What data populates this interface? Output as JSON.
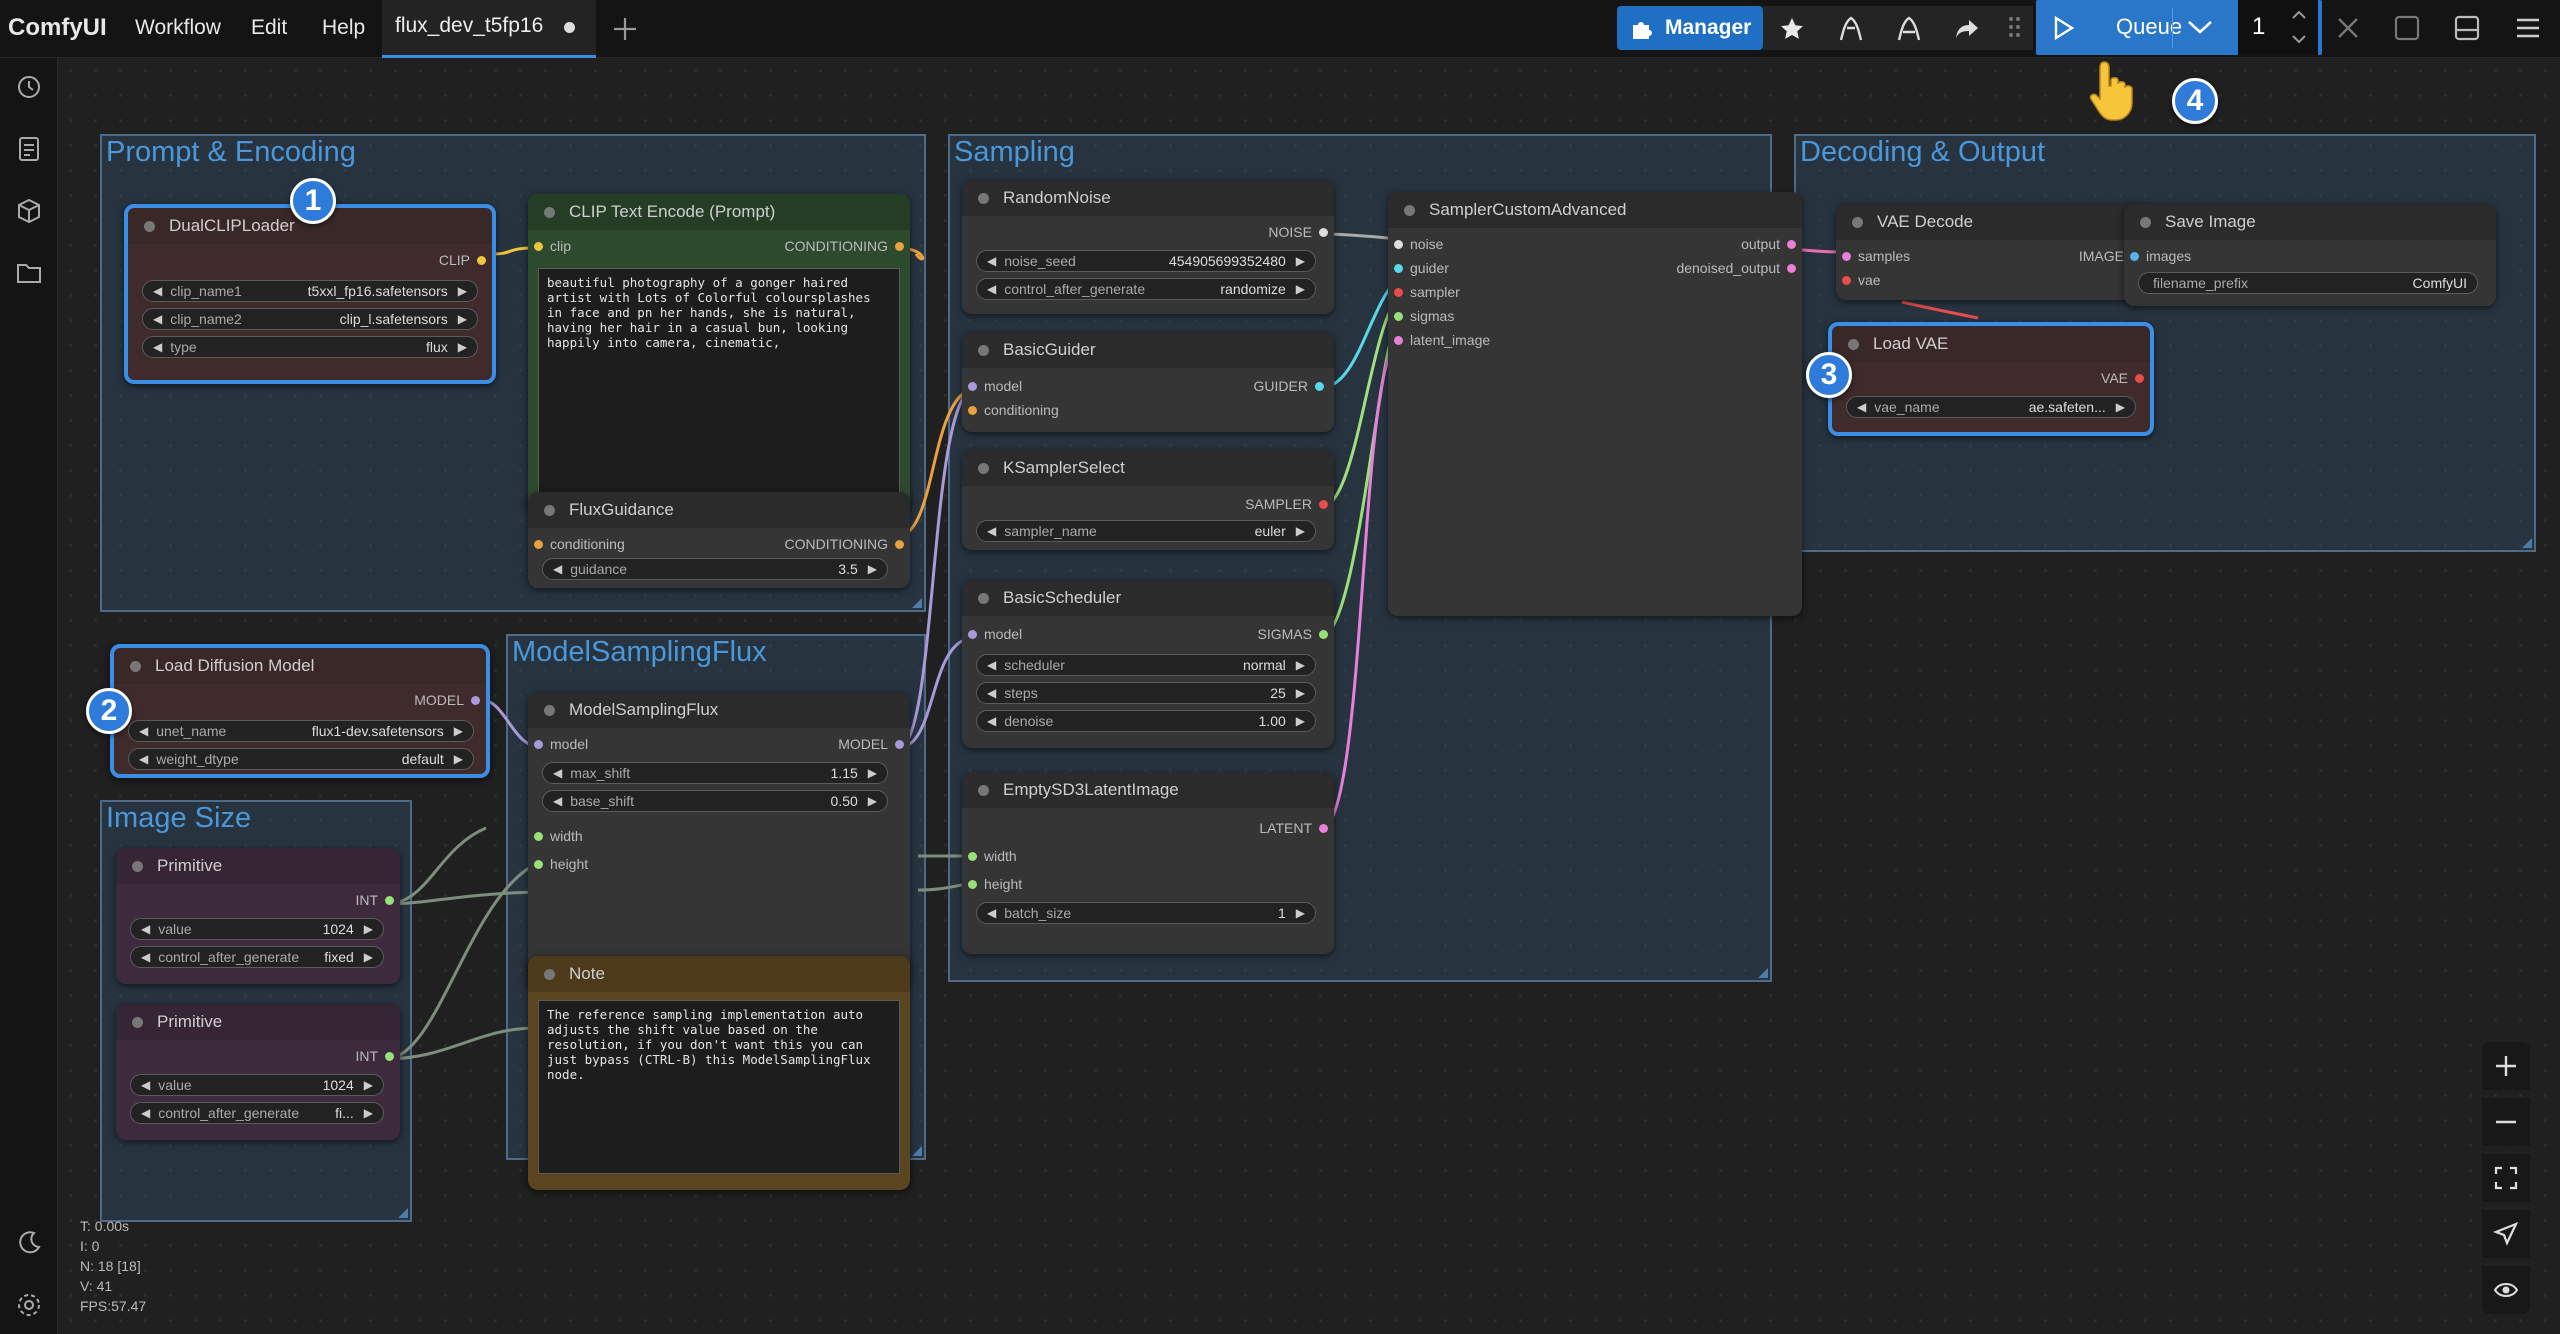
{
  "app": {
    "logo": "ComfyUI",
    "menu": [
      "Workflow",
      "Edit",
      "Help"
    ],
    "tab": "flux_dev_t5fp16",
    "new_tab_icon": "plus-icon"
  },
  "toolbar": {
    "manager_label": "Manager",
    "queue_label": "Queue",
    "queue_count": "1"
  },
  "colors": {
    "accent": "#2f7bd9",
    "manager": "#1f6fc5",
    "queue": "#2a76c9"
  },
  "groups": {
    "prompt": "Prompt & Encoding",
    "sampling": "Sampling",
    "decoding": "Decoding & Output",
    "model_sampling": "ModelSamplingFlux",
    "image_size": "Image Size"
  },
  "nodes": {
    "dualclip": {
      "title": "DualCLIPLoader",
      "out": "CLIP",
      "w1l": "clip_name1",
      "w1v": "t5xxl_fp16.safetensors",
      "w2l": "clip_name2",
      "w2v": "clip_l.safetensors",
      "w3l": "type",
      "w3v": "flux"
    },
    "cliptext": {
      "title": "CLIP Text Encode (Prompt)",
      "in": "clip",
      "out": "CONDITIONING",
      "text": "beautiful photography of a gonger haired artist with Lots of Colorful coloursplashes in face and pn her hands, she is natural, having her hair in a casual bun, looking happily into camera, cinematic,"
    },
    "fluxguidance": {
      "title": "FluxGuidance",
      "in": "conditioning",
      "out": "CONDITIONING",
      "wl": "guidance",
      "wv": "3.5"
    },
    "loaddiff": {
      "title": "Load Diffusion Model",
      "out": "MODEL",
      "w1l": "unet_name",
      "w1v": "flux1-dev.safetensors",
      "w2l": "weight_dtype",
      "w2v": "default"
    },
    "msf": {
      "title": "ModelSamplingFlux",
      "in1": "model",
      "out": "MODEL",
      "w1l": "max_shift",
      "w1v": "1.15",
      "w2l": "base_shift",
      "w2v": "0.50",
      "in2": "width",
      "in3": "height"
    },
    "prim1": {
      "title": "Primitive",
      "out": "INT",
      "w1l": "value",
      "w1v": "1024",
      "w2l": "control_after_generate",
      "w2v": "fixed"
    },
    "prim2": {
      "title": "Primitive",
      "out": "INT",
      "w1l": "value",
      "w1v": "1024",
      "w2l": "control_after_generate",
      "w2v": "fi..."
    },
    "note": {
      "title": "Note",
      "text": "The reference sampling implementation auto adjusts the shift value based on the resolution, if you don't want this you can just bypass (CTRL-B) this ModelSamplingFlux node."
    },
    "randnoise": {
      "title": "RandomNoise",
      "out": "NOISE",
      "w1l": "noise_seed",
      "w1v": "454905699352480",
      "w2l": "control_after_generate",
      "w2v": "randomize"
    },
    "guider": {
      "title": "BasicGuider",
      "in1": "model",
      "in2": "conditioning",
      "out": "GUIDER"
    },
    "ksel": {
      "title": "KSamplerSelect",
      "out": "SAMPLER",
      "wl": "sampler_name",
      "wv": "euler"
    },
    "sched": {
      "title": "BasicScheduler",
      "in": "model",
      "out": "SIGMAS",
      "w1l": "scheduler",
      "w1v": "normal",
      "w2l": "steps",
      "w2v": "25",
      "w3l": "denoise",
      "w3v": "1.00"
    },
    "latent": {
      "title": "EmptySD3LatentImage",
      "out": "LATENT",
      "in1": "width",
      "in2": "height",
      "wl": "batch_size",
      "wv": "1"
    },
    "sca": {
      "title": "SamplerCustomAdvanced",
      "in1": "noise",
      "in2": "guider",
      "in3": "sampler",
      "in4": "sigmas",
      "in5": "latent_image",
      "out1": "output",
      "out2": "denoised_output"
    },
    "vaedec": {
      "title": "VAE Decode",
      "in1": "samples",
      "in2": "vae",
      "out": "IMAGE"
    },
    "save": {
      "title": "Save Image",
      "in": "images",
      "wl": "filename_prefix",
      "wv": "ComfyUI"
    },
    "loadvae": {
      "title": "Load VAE",
      "out": "VAE",
      "wl": "vae_name",
      "wv": "ae.safeten..."
    }
  },
  "badges": [
    "1",
    "2",
    "3",
    "4"
  ],
  "stats": [
    "T: 0.00s",
    "I: 0",
    "N: 18 [18]",
    "V: 41",
    "FPS:57.47"
  ]
}
